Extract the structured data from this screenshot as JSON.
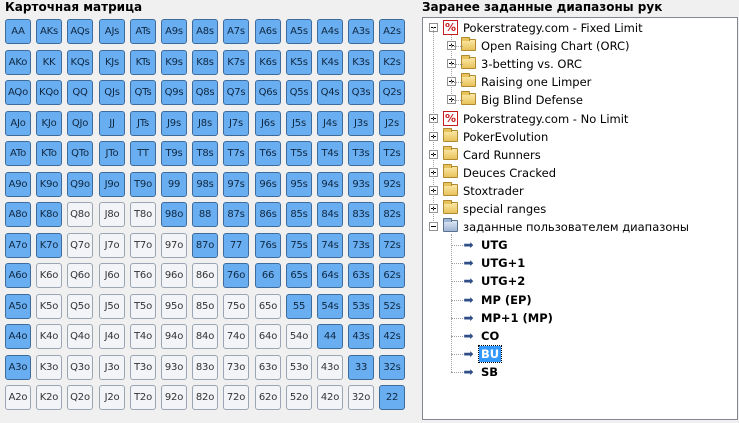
{
  "matrix_panel": {
    "title": "Карточная матрица",
    "rows": [
      [
        "AA",
        "AKs",
        "AQs",
        "AJs",
        "ATs",
        "A9s",
        "A8s",
        "A7s",
        "A6s",
        "A5s",
        "A4s",
        "A3s",
        "A2s"
      ],
      [
        "AKo",
        "KK",
        "KQs",
        "KJs",
        "KTs",
        "K9s",
        "K8s",
        "K7s",
        "K6s",
        "K5s",
        "K4s",
        "K3s",
        "K2s"
      ],
      [
        "AQo",
        "KQo",
        "QQ",
        "QJs",
        "QTs",
        "Q9s",
        "Q8s",
        "Q7s",
        "Q6s",
        "Q5s",
        "Q4s",
        "Q3s",
        "Q2s"
      ],
      [
        "AJo",
        "KJo",
        "QJo",
        "JJ",
        "JTs",
        "J9s",
        "J8s",
        "J7s",
        "J6s",
        "J5s",
        "J4s",
        "J3s",
        "J2s"
      ],
      [
        "ATo",
        "KTo",
        "QTo",
        "JTo",
        "TT",
        "T9s",
        "T8s",
        "T7s",
        "T6s",
        "T5s",
        "T4s",
        "T3s",
        "T2s"
      ],
      [
        "A9o",
        "K9o",
        "Q9o",
        "J9o",
        "T9o",
        "99",
        "98s",
        "97s",
        "96s",
        "95s",
        "94s",
        "93s",
        "92s"
      ],
      [
        "A8o",
        "K8o",
        "Q8o",
        "J8o",
        "T8o",
        "98o",
        "88",
        "87s",
        "86s",
        "85s",
        "84s",
        "83s",
        "82s"
      ],
      [
        "A7o",
        "K7o",
        "Q7o",
        "J7o",
        "T7o",
        "97o",
        "87o",
        "77",
        "76s",
        "75s",
        "74s",
        "73s",
        "72s"
      ],
      [
        "A6o",
        "K6o",
        "Q6o",
        "J6o",
        "T6o",
        "96o",
        "86o",
        "76o",
        "66",
        "65s",
        "64s",
        "63s",
        "62s"
      ],
      [
        "A5o",
        "K5o",
        "Q5o",
        "J5o",
        "T5o",
        "95o",
        "85o",
        "75o",
        "65o",
        "55",
        "54s",
        "53s",
        "52s"
      ],
      [
        "A4o",
        "K4o",
        "Q4o",
        "J4o",
        "T4o",
        "94o",
        "84o",
        "74o",
        "64o",
        "54o",
        "44",
        "43s",
        "42s"
      ],
      [
        "A3o",
        "K3o",
        "Q3o",
        "J3o",
        "T3o",
        "93o",
        "83o",
        "73o",
        "63o",
        "53o",
        "43o",
        "33",
        "32s"
      ],
      [
        "A2o",
        "K2o",
        "Q2o",
        "J2o",
        "T2o",
        "92o",
        "82o",
        "72o",
        "62o",
        "52o",
        "42o",
        "32o",
        "22"
      ]
    ],
    "selected": [
      [
        1,
        1,
        1,
        1,
        1,
        1,
        1,
        1,
        1,
        1,
        1,
        1,
        1
      ],
      [
        1,
        1,
        1,
        1,
        1,
        1,
        1,
        1,
        1,
        1,
        1,
        1,
        1
      ],
      [
        1,
        1,
        1,
        1,
        1,
        1,
        1,
        1,
        1,
        1,
        1,
        1,
        1
      ],
      [
        1,
        1,
        1,
        1,
        1,
        1,
        1,
        1,
        1,
        1,
        1,
        1,
        1
      ],
      [
        1,
        1,
        1,
        1,
        1,
        1,
        1,
        1,
        1,
        1,
        1,
        1,
        1
      ],
      [
        1,
        1,
        1,
        1,
        1,
        1,
        1,
        1,
        1,
        1,
        1,
        1,
        1
      ],
      [
        1,
        1,
        0,
        0,
        0,
        1,
        1,
        1,
        1,
        1,
        1,
        1,
        1
      ],
      [
        1,
        1,
        0,
        0,
        0,
        0,
        1,
        1,
        1,
        1,
        1,
        1,
        1
      ],
      [
        1,
        0,
        0,
        0,
        0,
        0,
        0,
        1,
        1,
        1,
        1,
        1,
        1
      ],
      [
        1,
        0,
        0,
        0,
        0,
        0,
        0,
        0,
        0,
        1,
        1,
        1,
        1
      ],
      [
        1,
        0,
        0,
        0,
        0,
        0,
        0,
        0,
        0,
        0,
        1,
        1,
        1
      ],
      [
        1,
        0,
        0,
        0,
        0,
        0,
        0,
        0,
        0,
        0,
        0,
        1,
        1
      ],
      [
        0,
        0,
        0,
        0,
        0,
        0,
        0,
        0,
        0,
        0,
        0,
        0,
        1
      ]
    ],
    "colors": {
      "selected": "#6aaef2",
      "unselected": "#f2f4f7"
    }
  },
  "ranges_panel": {
    "title": "Заранее заданные диапазоны рук",
    "tree": [
      {
        "label": "Pokerstrategy.com - Fixed Limit",
        "icon": "pokerstrategy-icon",
        "expanded": true,
        "children": [
          {
            "label": "Open Raising Chart (ORC)",
            "icon": "folder-icon",
            "expanded": false
          },
          {
            "label": "3-betting vs. ORC",
            "icon": "folder-icon",
            "expanded": false
          },
          {
            "label": "Raising one Limper",
            "icon": "folder-icon",
            "expanded": false
          },
          {
            "label": "Big Blind Defense",
            "icon": "folder-icon",
            "expanded": false
          }
        ]
      },
      {
        "label": "Pokerstrategy.com - No Limit",
        "icon": "pokerstrategy-icon",
        "expanded": false
      },
      {
        "label": "PokerEvolution",
        "icon": "folder-icon",
        "expanded": false
      },
      {
        "label": "Card Runners",
        "icon": "folder-icon",
        "expanded": false
      },
      {
        "label": "Deuces Cracked",
        "icon": "folder-icon",
        "expanded": false
      },
      {
        "label": "Stoxtrader",
        "icon": "folder-icon",
        "expanded": false
      },
      {
        "label": "special ranges",
        "icon": "folder-icon",
        "expanded": false
      },
      {
        "label": "заданные пользователем диапазоны",
        "icon": "user-folder-icon",
        "expanded": true,
        "children": [
          {
            "label": "UTG",
            "icon": "range-arrow-icon"
          },
          {
            "label": "UTG+1",
            "icon": "range-arrow-icon"
          },
          {
            "label": "UTG+2",
            "icon": "range-arrow-icon"
          },
          {
            "label": "MP (EP)",
            "icon": "range-arrow-icon"
          },
          {
            "label": "MP+1 (MP)",
            "icon": "range-arrow-icon"
          },
          {
            "label": "CO",
            "icon": "range-arrow-icon"
          },
          {
            "label": "BU",
            "icon": "range-arrow-icon",
            "selected": true
          },
          {
            "label": "SB",
            "icon": "range-arrow-icon"
          }
        ]
      }
    ],
    "selected_item": "BU"
  }
}
